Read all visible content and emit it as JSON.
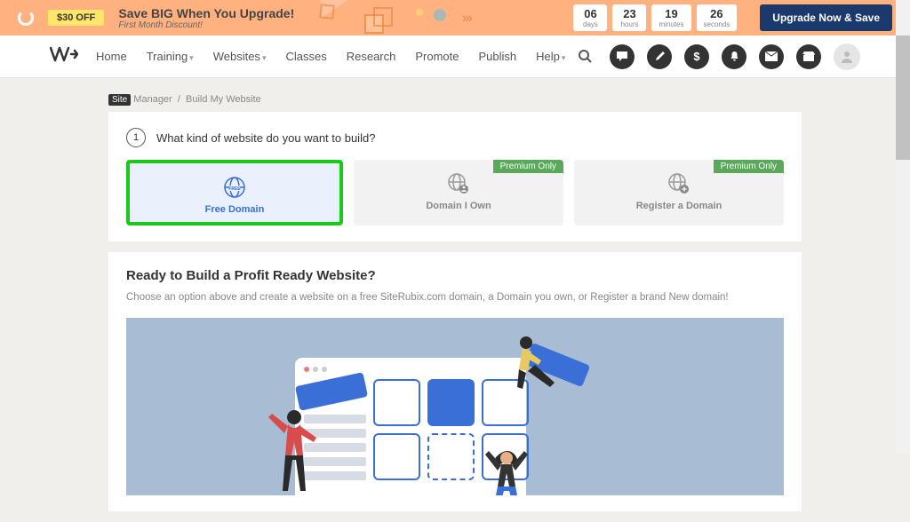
{
  "promo": {
    "tag": "$30 OFF",
    "headline": "Save BIG When You Upgrade!",
    "subline": "First Month Discount!",
    "countdown": [
      {
        "n": "06",
        "l": "days"
      },
      {
        "n": "23",
        "l": "hours"
      },
      {
        "n": "19",
        "l": "minutes"
      },
      {
        "n": "26",
        "l": "seconds"
      }
    ],
    "button": "Upgrade Now & Save"
  },
  "nav": {
    "links": [
      "Home",
      "Training",
      "Websites",
      "Classes",
      "Research",
      "Promote",
      "Publish",
      "Help"
    ],
    "dropdown_idx": [
      1,
      2,
      7
    ]
  },
  "breadcrumb": {
    "tag": "Site",
    "seg1": "Manager",
    "seg2": "Build My Website"
  },
  "step": {
    "num": "1",
    "title": "What kind of website do you want to build?"
  },
  "options": [
    {
      "label": "Free Domain",
      "selected": true,
      "premium": false
    },
    {
      "label": "Domain I Own",
      "selected": false,
      "premium": true
    },
    {
      "label": "Register a Domain",
      "selected": false,
      "premium": true
    }
  ],
  "premium_badge": "Premium Only",
  "ready": {
    "title": "Ready to Build a Profit Ready Website?",
    "desc": "Choose an option above and create a website on a free SiteRubix.com domain, a Domain you own, or Register a brand New domain!"
  }
}
